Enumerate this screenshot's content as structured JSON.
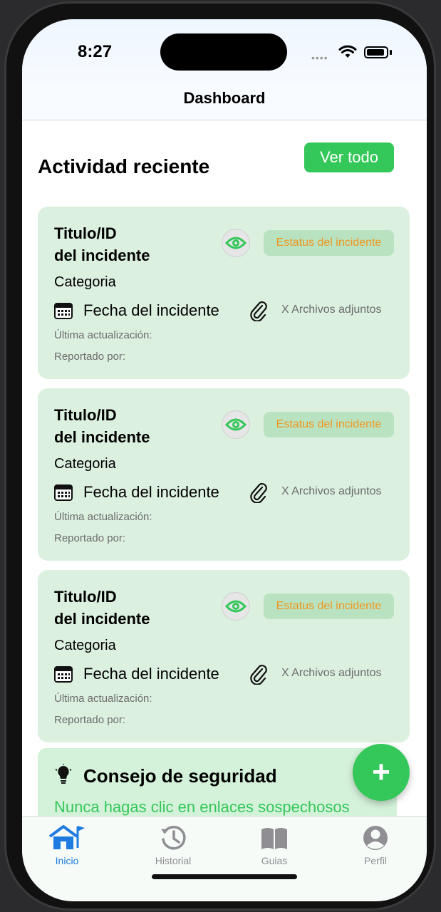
{
  "status_bar": {
    "time": "8:27"
  },
  "nav": {
    "title": "Dashboard"
  },
  "recent": {
    "title": "Actividad reciente",
    "see_all_label": "Ver todo",
    "cards": [
      {
        "title_line1": "Titulo/ID",
        "title_line2": "del incidente",
        "status": "Estatus del incidente",
        "category": "Categoria",
        "date": "Fecha del incidente",
        "attachments": "X Archivos adjuntos",
        "updated": "Última actualización:",
        "reported": "Reportado por:"
      },
      {
        "title_line1": "Titulo/ID",
        "title_line2": "del incidente",
        "status": "Estatus del incidente",
        "category": "Categoria",
        "date": "Fecha del incidente",
        "attachments": "X Archivos adjuntos",
        "updated": "Última actualización:",
        "reported": "Reportado por:"
      },
      {
        "title_line1": "Titulo/ID",
        "title_line2": "del incidente",
        "status": "Estatus del incidente",
        "category": "Categoria",
        "date": "Fecha del incidente",
        "attachments": "X Archivos adjuntos",
        "updated": "Última actualización:",
        "reported": "Reportado por:"
      }
    ]
  },
  "tip": {
    "icon": "lightbulb-icon",
    "title": "Consejo de seguridad",
    "text": "Nunca hagas clic en enlaces sospechosos"
  },
  "fab": {
    "label": "+"
  },
  "tabs": [
    {
      "label": "Inicio",
      "icon": "home-icon",
      "active": true
    },
    {
      "label": "Historial",
      "icon": "history-icon",
      "active": false
    },
    {
      "label": "Guias",
      "icon": "book-icon",
      "active": false
    },
    {
      "label": "Perfil",
      "icon": "person-icon",
      "active": false
    }
  ],
  "colors": {
    "accent_green": "#34c759",
    "card_bg": "#dcf0e0",
    "status_orange": "#f0951e",
    "tab_active": "#1e7be0",
    "tab_inactive": "#8e8e93"
  }
}
